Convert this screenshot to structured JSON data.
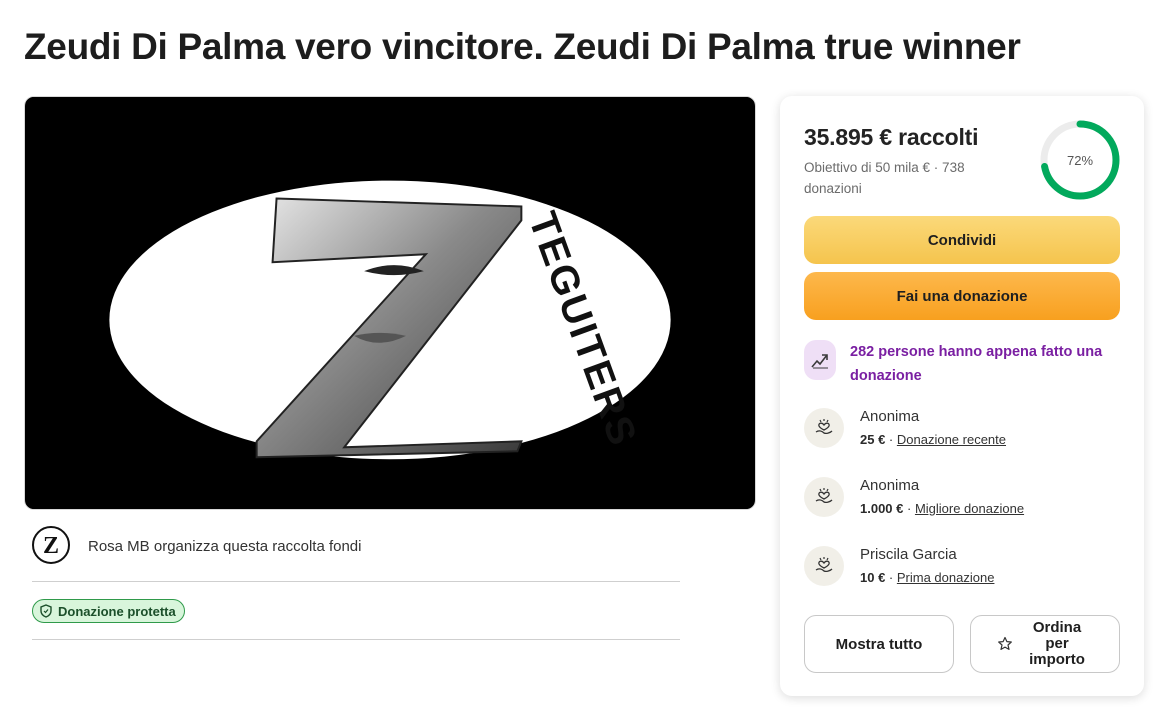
{
  "page": {
    "title": "Zeudi Di Palma vero vincitore. Zeudi Di Palma true winner"
  },
  "hero": {
    "logo_letter": "Z",
    "logo_text": "TEGUITERS"
  },
  "organizer": {
    "text": "Rosa MB organizza questa raccolta fondi"
  },
  "badge": {
    "label": "Donazione protetta"
  },
  "fundraiser": {
    "raised": "35.895 € raccolti",
    "goal_text": "Obiettivo di 50 mila € · 738 donazioni",
    "progress_label": "72%",
    "progress_fraction": 0.72,
    "share_label": "Condividi",
    "donate_label": "Fai una donazione",
    "trend_text": "282 persone hanno appena fatto una donazione",
    "donations": [
      {
        "name": "Anonima",
        "amount": "25 €",
        "separator": " · ",
        "tag": "Donazione recente"
      },
      {
        "name": "Anonima",
        "amount": "1.000 €",
        "separator": " · ",
        "tag": "Migliore donazione"
      },
      {
        "name": "Priscila Garcia",
        "amount": "10 €",
        "separator": " · ",
        "tag": "Prima donazione"
      }
    ],
    "show_all_label": "Mostra tutto",
    "sort_label": "Ordina per importo"
  },
  "colors": {
    "progress": "#02a95c",
    "share_button": "#f7cd5e",
    "donate_button": "#faa92c",
    "trend_text": "#7a1fa2",
    "badge_bg": "#d8f5db"
  },
  "icons": {
    "trend": "trending-up-icon",
    "donor": "heart-in-hand-icon",
    "badge": "shield-icon",
    "sort": "star-icon"
  }
}
